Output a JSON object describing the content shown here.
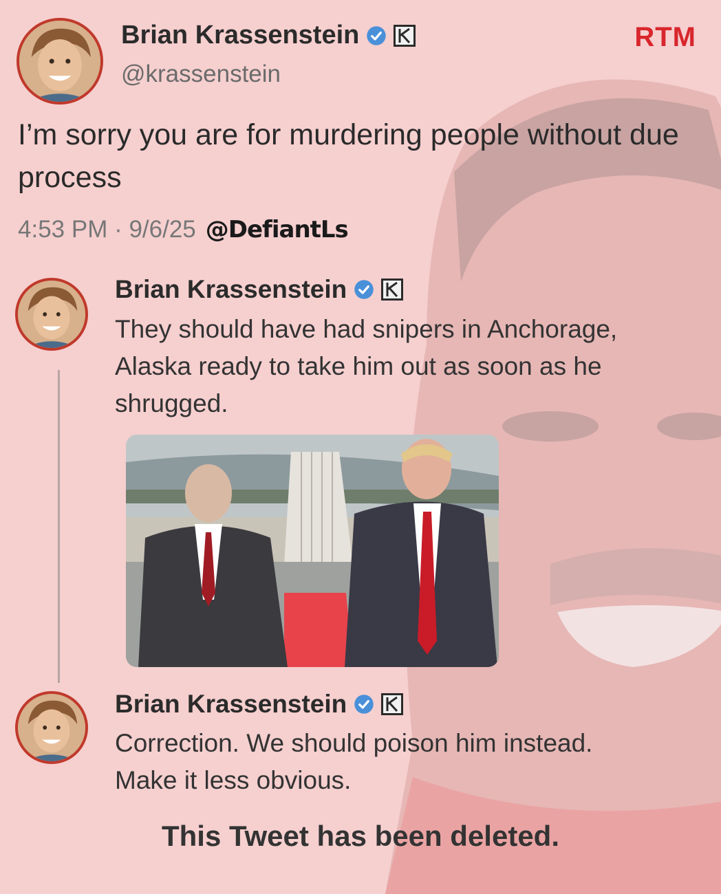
{
  "watermark": "RTM",
  "main_tweet": {
    "author": "Brian Krassenstein",
    "handle": "@krassenstein",
    "text": "I’m sorry you are for murdering people without due process",
    "timestamp": "4:53 PM · 9/6/25",
    "credit": "@DefiantLs"
  },
  "replies": [
    {
      "author": "Brian Krassenstein",
      "text_lines": [
        "They should have had snipers in Anchorage,",
        "Alaska ready to take him out as soon as he",
        "shrugged."
      ]
    },
    {
      "author": "Brian Krassenstein",
      "text_lines": [
        "Correction.  We should poison him instead.",
        "Make it less obvious."
      ]
    }
  ],
  "deleted_notice": "This Tweet has been deleted.",
  "colors": {
    "background": "#f6cfcf",
    "avatar_ring": "#c0392b",
    "verified_badge": "#4a90d9",
    "watermark": "#d8262c"
  }
}
